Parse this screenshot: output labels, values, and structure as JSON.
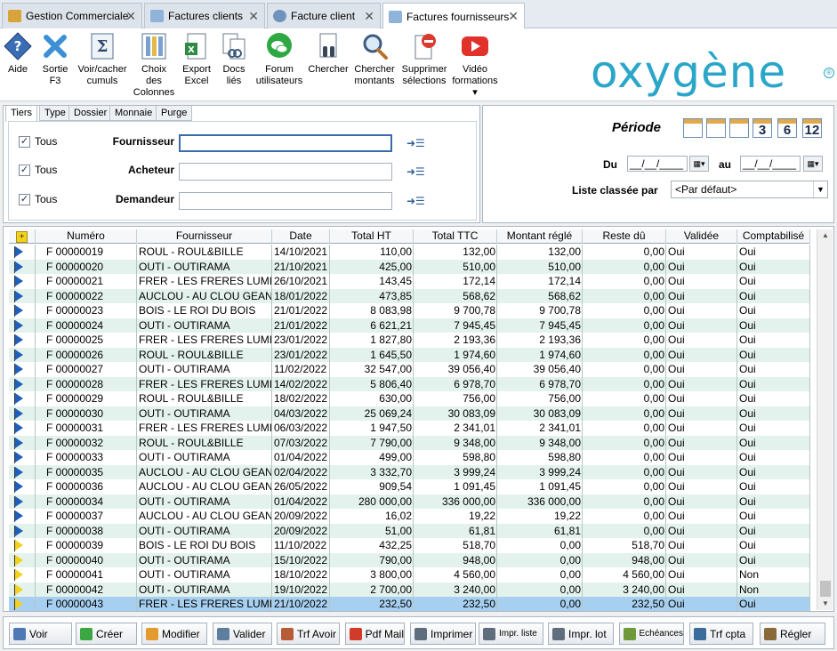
{
  "tabs": [
    {
      "label": "Gestion Commerciale",
      "icon": "cash-register-icon"
    },
    {
      "label": "Factures clients",
      "icon": "document-icon"
    },
    {
      "label": "Facture client",
      "icon": "gears-icon"
    },
    {
      "label": "Factures fournisseurs",
      "icon": "document-icon",
      "active": true
    }
  ],
  "toolbar": [
    {
      "id": "aide",
      "lines": [
        "Aide"
      ],
      "icon": "help-diamond-icon"
    },
    {
      "id": "sortie",
      "lines": [
        "Sortie",
        "F3"
      ],
      "icon": "close-x-icon"
    },
    {
      "id": "cumuls",
      "lines": [
        "Voir/cacher",
        "cumuls"
      ],
      "icon": "sigma-icon"
    },
    {
      "id": "colonnes",
      "lines": [
        "Choix",
        "des",
        "Colonnes"
      ],
      "icon": "columns-icon"
    },
    {
      "id": "excel",
      "lines": [
        "Export",
        "Excel"
      ],
      "icon": "excel-icon"
    },
    {
      "id": "docs",
      "lines": [
        "Docs",
        "liés"
      ],
      "icon": "linked-docs-icon"
    },
    {
      "id": "forum",
      "lines": [
        "Forum",
        "utilisateurs"
      ],
      "icon": "forum-bubble-icon"
    },
    {
      "id": "chercher",
      "lines": [
        "Chercher"
      ],
      "icon": "binoculars-icon"
    },
    {
      "id": "montants",
      "lines": [
        "Chercher",
        "montants"
      ],
      "icon": "magnifier-icon"
    },
    {
      "id": "supprimer",
      "lines": [
        "Supprimer",
        "sélections"
      ],
      "icon": "delete-selection-icon"
    },
    {
      "id": "video",
      "lines": [
        "Vidéo",
        "formations",
        "▾"
      ],
      "icon": "video-play-icon"
    }
  ],
  "logo_text": "oxygène",
  "logo_reg": "®",
  "filter_tabs": [
    "Tiers",
    "Type",
    "Dossier",
    "Monnaie",
    "Purge"
  ],
  "filters": [
    {
      "checkbox_label": "Tous",
      "checked": true,
      "field": "Fournisseur",
      "value": ""
    },
    {
      "checkbox_label": "Tous",
      "checked": true,
      "field": "Acheteur",
      "value": ""
    },
    {
      "checkbox_label": "Tous",
      "checked": true,
      "field": "Demandeur",
      "value": ""
    }
  ],
  "period": {
    "title": "Période",
    "icons": [
      {
        "name": "calendar-day-icon",
        "text": ""
      },
      {
        "name": "calendar-week-icon",
        "text": ""
      },
      {
        "name": "calendar-month-icon",
        "text": ""
      },
      {
        "name": "calendar-3-icon",
        "text": "3"
      },
      {
        "name": "calendar-6-icon",
        "text": "6"
      },
      {
        "name": "calendar-12-icon",
        "text": "12"
      }
    ],
    "du_label": "Du",
    "au_label": "au",
    "du_value": "__/__/____",
    "au_value": "__/__/____",
    "sort_label": "Liste classée par",
    "sort_value": "<Par défaut>"
  },
  "grid": {
    "columns": [
      "",
      "Numéro",
      "Fournisseur",
      "Date",
      "Total HT",
      "Total TTC",
      "Montant réglé",
      "Reste dû",
      "Validée",
      "Comptabilisé"
    ],
    "rows": [
      {
        "flag": "blue",
        "num": "F 00000019",
        "four": "ROUL - ROUL&BILLE",
        "date": "14/10/2021",
        "ht": "110,00",
        "ttc": "132,00",
        "regle": "132,00",
        "reste": "0,00",
        "val": "Oui",
        "compta": "Oui"
      },
      {
        "flag": "blue",
        "num": "F 00000020",
        "four": "OUTI - OUTIRAMA",
        "date": "21/10/2021",
        "ht": "425,00",
        "ttc": "510,00",
        "regle": "510,00",
        "reste": "0,00",
        "val": "Oui",
        "compta": "Oui"
      },
      {
        "flag": "blue",
        "num": "F 00000021",
        "four": "FRER - LES FRERES LUMI",
        "date": "26/10/2021",
        "ht": "143,45",
        "ttc": "172,14",
        "regle": "172,14",
        "reste": "0,00",
        "val": "Oui",
        "compta": "Oui"
      },
      {
        "flag": "blue",
        "num": "F 00000022",
        "four": "AUCLOU - AU CLOU GEANT",
        "date": "18/01/2022",
        "ht": "473,85",
        "ttc": "568,62",
        "regle": "568,62",
        "reste": "0,00",
        "val": "Oui",
        "compta": "Oui"
      },
      {
        "flag": "blue",
        "num": "F 00000023",
        "four": "BOIS - LE ROI DU BOIS",
        "date": "21/01/2022",
        "ht": "8 083,98",
        "ttc": "9 700,78",
        "regle": "9 700,78",
        "reste": "0,00",
        "val": "Oui",
        "compta": "Oui"
      },
      {
        "flag": "blue",
        "num": "F 00000024",
        "four": "OUTI - OUTIRAMA",
        "date": "21/01/2022",
        "ht": "6 621,21",
        "ttc": "7 945,45",
        "regle": "7 945,45",
        "reste": "0,00",
        "val": "Oui",
        "compta": "Oui"
      },
      {
        "flag": "blue",
        "num": "F 00000025",
        "four": "FRER - LES FRERES LUMI",
        "date": "23/01/2022",
        "ht": "1 827,80",
        "ttc": "2 193,36",
        "regle": "2 193,36",
        "reste": "0,00",
        "val": "Oui",
        "compta": "Oui"
      },
      {
        "flag": "blue",
        "num": "F 00000026",
        "four": "ROUL - ROUL&BILLE",
        "date": "23/01/2022",
        "ht": "1 645,50",
        "ttc": "1 974,60",
        "regle": "1 974,60",
        "reste": "0,00",
        "val": "Oui",
        "compta": "Oui"
      },
      {
        "flag": "blue",
        "num": "F 00000027",
        "four": "OUTI - OUTIRAMA",
        "date": "11/02/2022",
        "ht": "32 547,00",
        "ttc": "39 056,40",
        "regle": "39 056,40",
        "reste": "0,00",
        "val": "Oui",
        "compta": "Oui"
      },
      {
        "flag": "blue",
        "num": "F 00000028",
        "four": "FRER - LES FRERES LUMI",
        "date": "14/02/2022",
        "ht": "5 806,40",
        "ttc": "6 978,70",
        "regle": "6 978,70",
        "reste": "0,00",
        "val": "Oui",
        "compta": "Oui"
      },
      {
        "flag": "blue",
        "num": "F 00000029",
        "four": "ROUL - ROUL&BILLE",
        "date": "18/02/2022",
        "ht": "630,00",
        "ttc": "756,00",
        "regle": "756,00",
        "reste": "0,00",
        "val": "Oui",
        "compta": "Oui"
      },
      {
        "flag": "blue",
        "num": "F 00000030",
        "four": "OUTI - OUTIRAMA",
        "date": "04/03/2022",
        "ht": "25 069,24",
        "ttc": "30 083,09",
        "regle": "30 083,09",
        "reste": "0,00",
        "val": "Oui",
        "compta": "Oui"
      },
      {
        "flag": "blue",
        "num": "F 00000031",
        "four": "FRER - LES FRERES LUMI",
        "date": "06/03/2022",
        "ht": "1 947,50",
        "ttc": "2 341,01",
        "regle": "2 341,01",
        "reste": "0,00",
        "val": "Oui",
        "compta": "Oui"
      },
      {
        "flag": "blue",
        "num": "F 00000032",
        "four": "ROUL - ROUL&BILLE",
        "date": "07/03/2022",
        "ht": "7 790,00",
        "ttc": "9 348,00",
        "regle": "9 348,00",
        "reste": "0,00",
        "val": "Oui",
        "compta": "Oui"
      },
      {
        "flag": "blue",
        "num": "F 00000033",
        "four": "OUTI - OUTIRAMA",
        "date": "01/04/2022",
        "ht": "499,00",
        "ttc": "598,80",
        "regle": "598,80",
        "reste": "0,00",
        "val": "Oui",
        "compta": "Oui"
      },
      {
        "flag": "blue",
        "num": "F 00000035",
        "four": "AUCLOU - AU CLOU GEANT",
        "date": "02/04/2022",
        "ht": "3 332,70",
        "ttc": "3 999,24",
        "regle": "3 999,24",
        "reste": "0,00",
        "val": "Oui",
        "compta": "Oui"
      },
      {
        "flag": "blue",
        "num": "F 00000036",
        "four": "AUCLOU - AU CLOU GEANT",
        "date": "26/05/2022",
        "ht": "909,54",
        "ttc": "1 091,45",
        "regle": "1 091,45",
        "reste": "0,00",
        "val": "Oui",
        "compta": "Oui"
      },
      {
        "flag": "blue",
        "num": "F 00000034",
        "four": "OUTI - OUTIRAMA",
        "date": "01/04/2022",
        "ht": "280 000,00",
        "ttc": "336 000,00",
        "regle": "336 000,00",
        "reste": "0,00",
        "val": "Oui",
        "compta": "Oui"
      },
      {
        "flag": "blue",
        "num": "F 00000037",
        "four": "AUCLOU - AU CLOU GEANT",
        "date": "20/09/2022",
        "ht": "16,02",
        "ttc": "19,22",
        "regle": "19,22",
        "reste": "0,00",
        "val": "Oui",
        "compta": "Oui"
      },
      {
        "flag": "blue",
        "num": "F 00000038",
        "four": "OUTI - OUTIRAMA",
        "date": "20/09/2022",
        "ht": "51,00",
        "ttc": "61,81",
        "regle": "61,81",
        "reste": "0,00",
        "val": "Oui",
        "compta": "Oui"
      },
      {
        "flag": "yellow",
        "num": "F 00000039",
        "four": "BOIS - LE ROI DU BOIS",
        "date": "11/10/2022",
        "ht": "432,25",
        "ttc": "518,70",
        "regle": "0,00",
        "reste": "518,70",
        "val": "Oui",
        "compta": "Oui"
      },
      {
        "flag": "yellow",
        "num": "F 00000040",
        "four": "OUTI - OUTIRAMA",
        "date": "15/10/2022",
        "ht": "790,00",
        "ttc": "948,00",
        "regle": "0,00",
        "reste": "948,00",
        "val": "Oui",
        "compta": "Oui"
      },
      {
        "flag": "yellow",
        "num": "F 00000041",
        "four": "OUTI - OUTIRAMA",
        "date": "18/10/2022",
        "ht": "3 800,00",
        "ttc": "4 560,00",
        "regle": "0,00",
        "reste": "4 560,00",
        "val": "Oui",
        "compta": "Non"
      },
      {
        "flag": "yellow",
        "num": "F 00000042",
        "four": "OUTI - OUTIRAMA",
        "date": "19/10/2022",
        "ht": "2 700,00",
        "ttc": "3 240,00",
        "regle": "0,00",
        "reste": "3 240,00",
        "val": "Oui",
        "compta": "Non"
      },
      {
        "flag": "yellow",
        "num": "F 00000043",
        "four": "FRER - LES FRERES LUMI",
        "date": "21/10/2022",
        "ht": "232,50",
        "ttc": "232,50",
        "regle": "0,00",
        "reste": "232,50",
        "val": "Oui",
        "compta": "Oui",
        "selected": true
      }
    ]
  },
  "buttons": [
    {
      "id": "voir",
      "label": "Voir",
      "icon": "view-icon",
      "color": "#4f79b5"
    },
    {
      "id": "creer",
      "label": "Créer",
      "icon": "plus-circle-icon",
      "color": "#3aa742"
    },
    {
      "id": "modifier",
      "label": "Modifier",
      "icon": "pencil-icon",
      "color": "#e39b2f"
    },
    {
      "id": "valider",
      "label": "Valider",
      "icon": "validate-icon",
      "color": "#5e7e9e"
    },
    {
      "id": "trfavoir",
      "label": "Trf Avoir",
      "icon": "transfer-icon",
      "color": "#b85c38"
    },
    {
      "id": "pdfmail",
      "label": "Pdf Mail",
      "icon": "pdf-icon",
      "color": "#d23a2a"
    },
    {
      "id": "imprimer",
      "label": "Imprimer",
      "icon": "printer-icon",
      "color": "#5f6d7c"
    },
    {
      "id": "imprliste",
      "label": "Impr. liste",
      "icon": "print-list-icon",
      "color": "#5f6d7c",
      "small": true
    },
    {
      "id": "imprlot",
      "label": "Impr. lot",
      "icon": "print-batch-icon",
      "color": "#5f6d7c"
    },
    {
      "id": "echeances",
      "label": "Echéances",
      "icon": "calendar-due-icon",
      "color": "#6f9a3c",
      "small": true
    },
    {
      "id": "trfcpta",
      "label": "Trf cpta",
      "icon": "accounting-transfer-icon",
      "color": "#3b6d9c"
    },
    {
      "id": "regler",
      "label": "Régler",
      "icon": "payment-icon",
      "color": "#8a6a3b"
    }
  ]
}
